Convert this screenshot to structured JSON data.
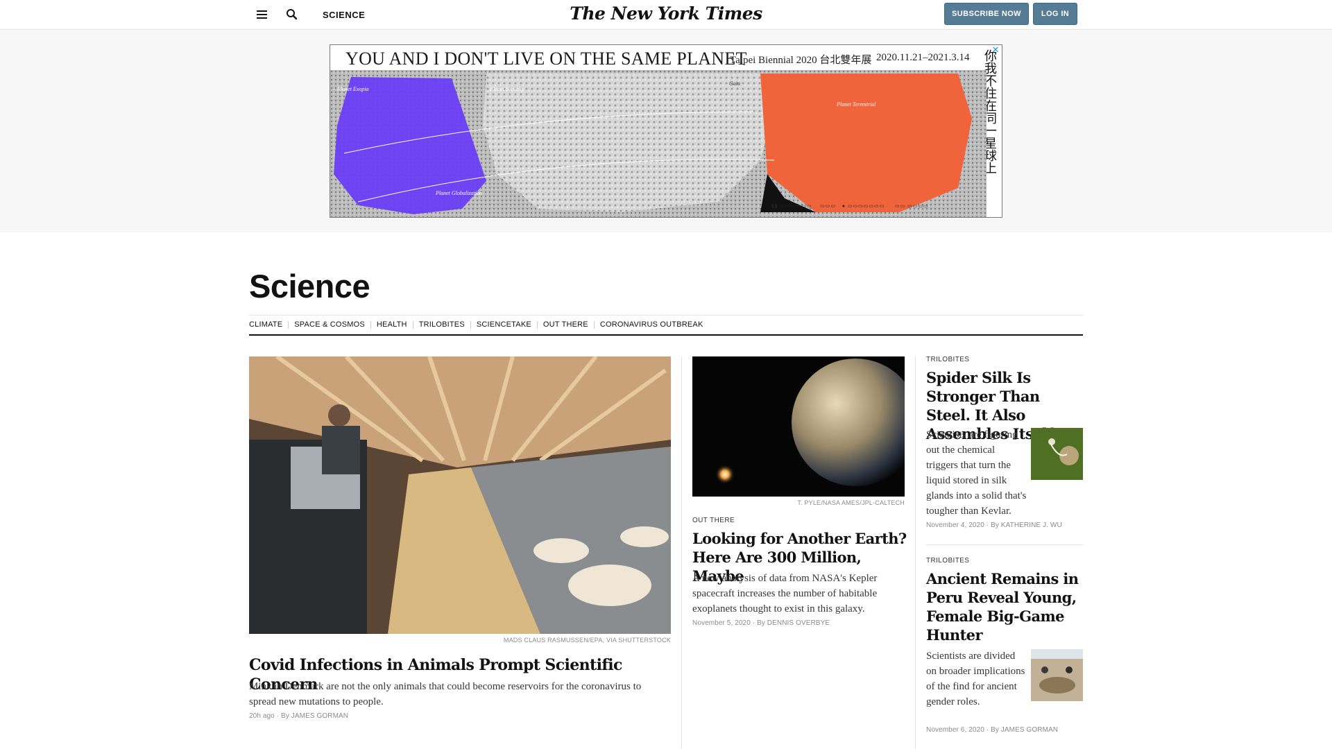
{
  "masthead": {
    "section_label": "SCIENCE",
    "logo": "The New York Times",
    "subscribe_label": "SUBSCRIBE NOW",
    "login_label": "LOG IN"
  },
  "ad": {
    "title": "YOU AND I DON'T LIVE ON THE SAME PLANET",
    "biennial": "Taipei Biennial 2020 台北雙年展",
    "dates": "2020.11.21–2021.3.14",
    "vertical_text": "你我不住在同一星球上",
    "close_icon": "close-x",
    "map_labels": [
      "Planet Exopia",
      "Planet Security",
      "Gaia",
      "Planet Terrestrial",
      "Planet Globalization"
    ],
    "colors": {
      "purple": "#6a3df5",
      "orange": "#f0643c"
    }
  },
  "section": {
    "title": "Science",
    "subnav": [
      "CLIMATE",
      "SPACE & COSMOS",
      "HEALTH",
      "TRILOBITES",
      "SCIENCETAKE",
      "OUT THERE",
      "CORONAVIRUS OUTBREAK"
    ]
  },
  "lead": {
    "credit": "MADS CLAUS RASMUSSEN/EPA, VIA SHUTTERSTOCK",
    "headline": "Covid Infections in Animals Prompt Scientific Concern",
    "summary": "Mink in Denmark are not the only animals that could become reservoirs for the coronavirus to spread new mutations to people.",
    "time": "20h ago",
    "byline": "By JAMES GORMAN"
  },
  "middle": {
    "credit": "T. PYLE/NASA AMES/JPL-CALTECH",
    "kicker": "OUT THERE",
    "headline": "Looking for Another Earth? Here Are 300 Million, Maybe",
    "summary": "A new analysis of data from NASA's Kepler spacecraft increases the number of habitable exoplanets thought to exist in this galaxy.",
    "date": "November 5, 2020",
    "byline": "By DENNIS OVERBYE"
  },
  "right": [
    {
      "kicker": "TRILOBITES",
      "headline": "Spider Silk Is Stronger Than Steel. It Also Assembles Itself.",
      "summary": "Scientists are figuring out the chemical triggers that turn the liquid stored in silk glands into a solid that's tougher than Kevlar.",
      "date": "November 4, 2020",
      "byline": "By KATHERINE J. WU"
    },
    {
      "kicker": "TRILOBITES",
      "headline": "Ancient Remains in Peru Reveal Young, Female Big-Game Hunter",
      "summary": "Scientists are divided on broader implications of the find for ancient gender roles.",
      "date": "November 6, 2020",
      "byline": "By JAMES GORMAN"
    }
  ]
}
